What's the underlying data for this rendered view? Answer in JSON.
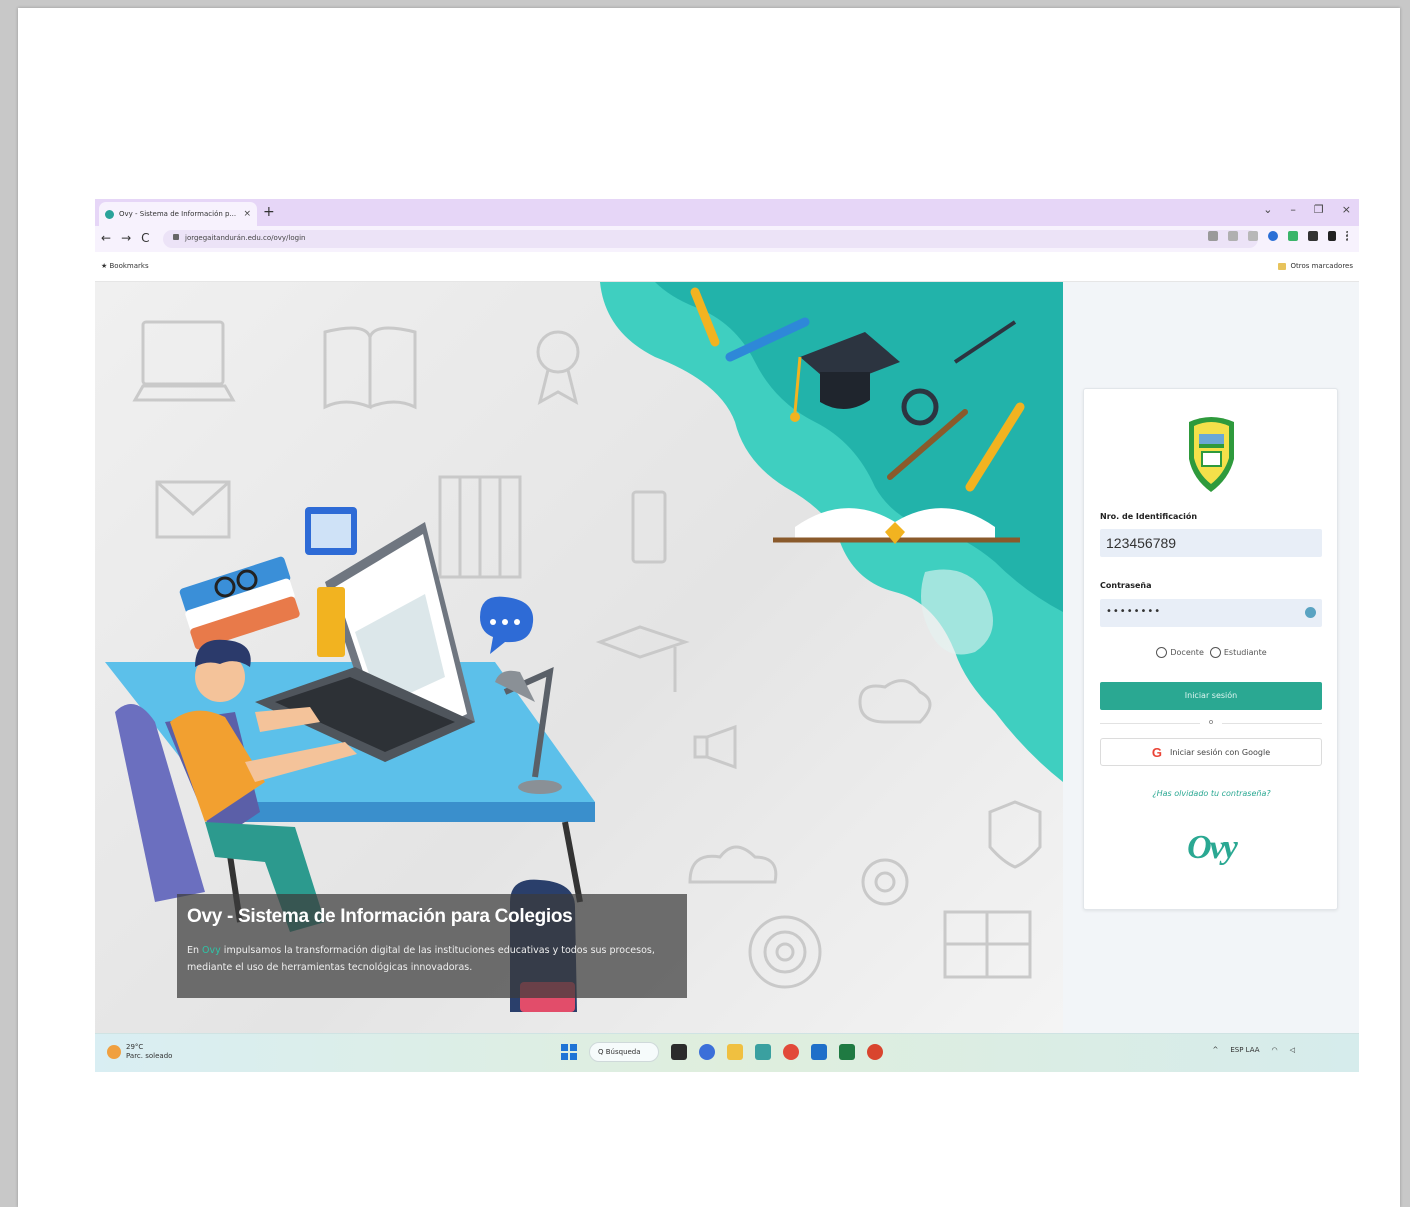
{
  "browser": {
    "tab_title": "Ovy - Sistema de Información p...",
    "tab_close": "×",
    "new_tab": "+",
    "url": "jorgegaitandurán.edu.co/ovy/login",
    "back": "←",
    "forward": "→",
    "reload": "C",
    "bookmark_left": "★ Bookmarks",
    "bookmark_right": "Otros marcadores",
    "win_min": "–",
    "win_max": "❐",
    "win_close": "×",
    "win_chevron": "⌄"
  },
  "hero": {
    "title": "Ovy - Sistema de Información para Colegios",
    "text_prefix": "En ",
    "text_brand": "Ovy",
    "text_body": " impulsamos la transformación digital de las instituciones educativas y todos sus procesos, mediante el uso de herramientas tecnológicas innovadoras."
  },
  "login": {
    "id_label": "Nro. de Identificación",
    "id_value": "123456789",
    "password_label": "Contraseña",
    "password_value": "••••••••",
    "role_docente": "Docente",
    "role_estudiante": "Estudiante",
    "login_button": "Iniciar sesión",
    "or_text": "o",
    "google_button": "Iniciar sesión con Google",
    "google_glyph": "G",
    "forgot_link": "¿Has olvidado tu contraseña?",
    "brand_logo": "Ovy"
  },
  "taskbar": {
    "weather_temp": "29°C",
    "weather_desc": "Parc. soleado",
    "search_label": "Q Búsqueda",
    "lang": "ESP LAA",
    "tray_chevron": "^"
  },
  "colors": {
    "accent": "#2aa892",
    "teal_blob": "#3fcfc0",
    "tabbar": "#e6d6f7"
  }
}
